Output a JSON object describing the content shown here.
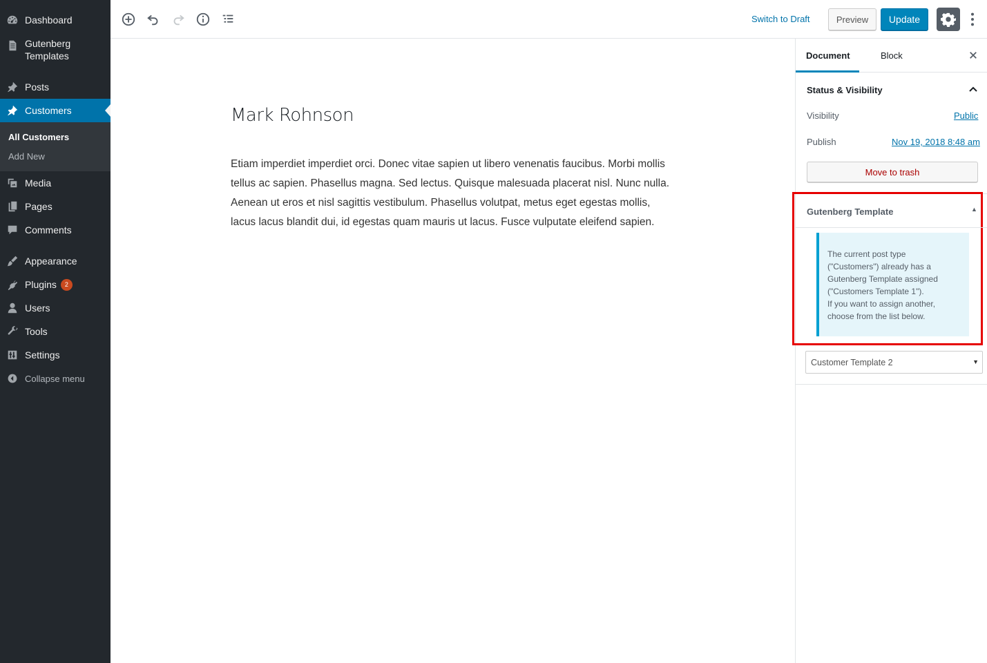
{
  "admin_menu": {
    "items": [
      {
        "label": "Dashboard",
        "icon": "dashboard-icon"
      },
      {
        "label": "Gutenberg\nTemplates",
        "icon": "document-icon"
      },
      {
        "label": "Posts",
        "icon": "pin-icon"
      },
      {
        "label": "Customers",
        "icon": "pin-icon"
      },
      {
        "label": "Media",
        "icon": "media-icon"
      },
      {
        "label": "Pages",
        "icon": "pages-icon"
      },
      {
        "label": "Comments",
        "icon": "comments-icon"
      },
      {
        "label": "Appearance",
        "icon": "brush-icon"
      },
      {
        "label": "Plugins",
        "icon": "plugin-icon",
        "badge": "2"
      },
      {
        "label": "Users",
        "icon": "users-icon"
      },
      {
        "label": "Tools",
        "icon": "wrench-icon"
      },
      {
        "label": "Settings",
        "icon": "settings-sliders-icon"
      },
      {
        "label": "Collapse menu",
        "icon": "collapse-icon"
      }
    ],
    "submenu": [
      {
        "label": "All Customers"
      },
      {
        "label": "Add New"
      }
    ]
  },
  "toolbar": {
    "switch_to_draft": "Switch to Draft",
    "preview": "Preview",
    "update": "Update"
  },
  "post": {
    "title": "Mark Rohnson",
    "body": "Etiam imperdiet imperdiet orci. Donec vitae sapien ut libero venenatis faucibus. Morbi mollis tellus ac sapien. Phasellus magna. Sed lectus. Quisque malesuada placerat nisl. Nunc nulla. Aenean ut eros et nisl sagittis vestibulum. Phasellus volutpat, metus eget egestas mollis, lacus lacus blandit dui, id egestas quam mauris ut lacus. Fusce vulputate eleifend sapien."
  },
  "sidebar": {
    "tabs": [
      "Document",
      "Block"
    ],
    "status_panel": {
      "title": "Status & Visibility",
      "visibility_label": "Visibility",
      "visibility_value": "Public",
      "publish_label": "Publish",
      "publish_value": "Nov 19, 2018 8:48 am",
      "trash_label": "Move to trash"
    },
    "template_panel": {
      "title": "Gutenberg Template",
      "notice_lines": [
        "The current post type",
        "(\"Customers\") already has a",
        "Gutenberg Template assigned",
        "(\"Customers Template 1\").",
        "If you want to assign another,",
        "choose from the list below."
      ],
      "selected_option": "Customer Template 2"
    }
  },
  "colors": {
    "accent": "#0085ba",
    "menu_bg": "#23282d",
    "highlight": "#e60000"
  }
}
